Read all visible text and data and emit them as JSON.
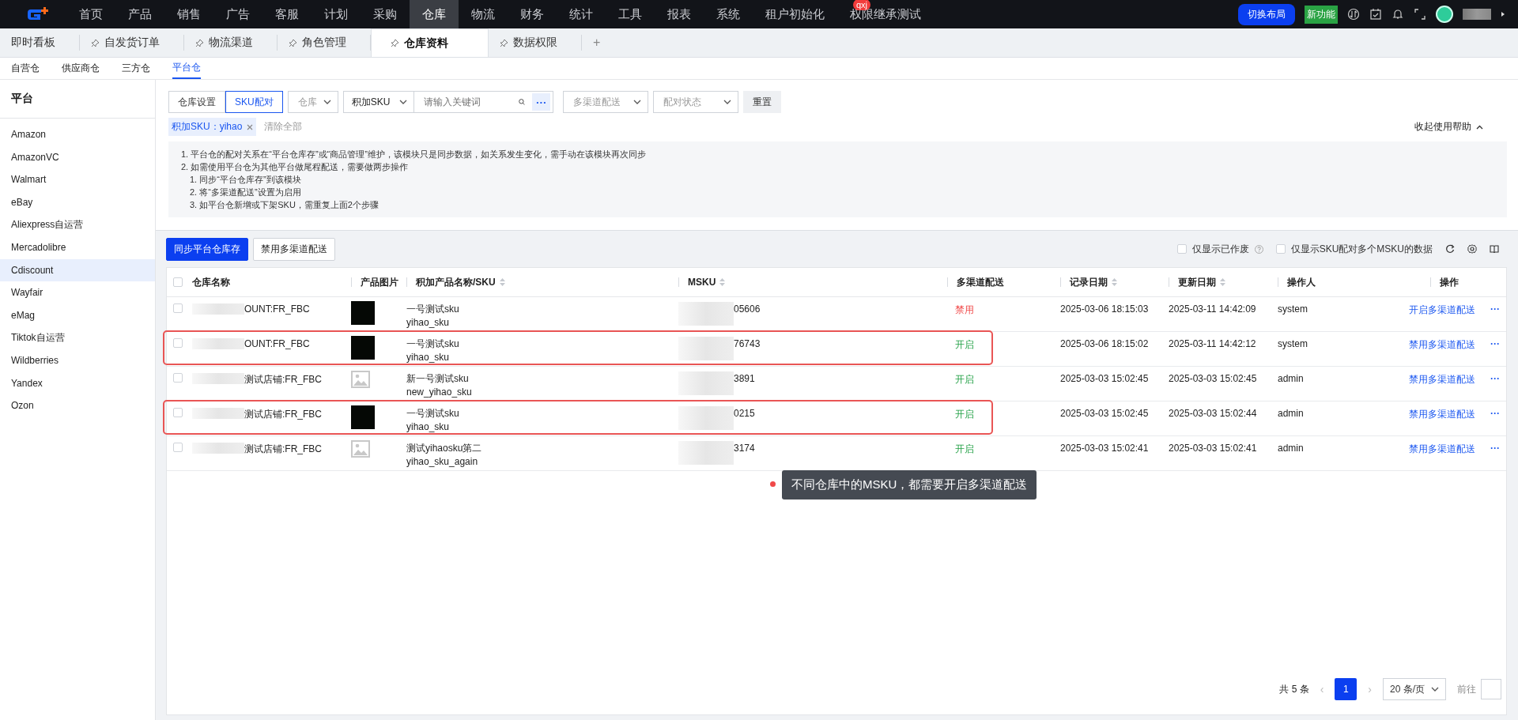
{
  "top_nav": {
    "items": [
      {
        "label": "首页",
        "selected": false
      },
      {
        "label": "产品",
        "selected": false
      },
      {
        "label": "销售",
        "selected": false
      },
      {
        "label": "广告",
        "selected": false
      },
      {
        "label": "客服",
        "selected": false
      },
      {
        "label": "计划",
        "selected": false
      },
      {
        "label": "采购",
        "selected": false
      },
      {
        "label": "仓库",
        "selected": true
      },
      {
        "label": "物流",
        "selected": false
      },
      {
        "label": "财务",
        "selected": false
      },
      {
        "label": "统计",
        "selected": false
      },
      {
        "label": "工具",
        "selected": false
      },
      {
        "label": "报表",
        "selected": false
      },
      {
        "label": "系统",
        "selected": false
      },
      {
        "label": "租户初始化",
        "selected": false
      },
      {
        "label": "权限继承测试",
        "selected": false,
        "badge": "qxj"
      }
    ],
    "layout_button": "切换布局",
    "new_feature": "新功能"
  },
  "tabs": [
    {
      "label": "即时看板",
      "selected": false,
      "pinned": false
    },
    {
      "label": "自发货订单",
      "selected": false,
      "pinned": true
    },
    {
      "label": "物流渠道",
      "selected": false,
      "pinned": true
    },
    {
      "label": "角色管理",
      "selected": false,
      "pinned": true
    },
    {
      "label": "仓库资料",
      "selected": true,
      "pinned": true
    },
    {
      "label": "数据权限",
      "selected": false,
      "pinned": true
    }
  ],
  "add_tab": "+",
  "sub_tabs": [
    {
      "label": "自营仓",
      "selected": false
    },
    {
      "label": "供应商仓",
      "selected": false
    },
    {
      "label": "三方仓",
      "selected": false
    },
    {
      "label": "平台仓",
      "selected": true
    }
  ],
  "sidebar": {
    "title": "平台",
    "items": [
      {
        "label": "Amazon",
        "selected": false
      },
      {
        "label": "AmazonVC",
        "selected": false
      },
      {
        "label": "Walmart",
        "selected": false
      },
      {
        "label": "eBay",
        "selected": false
      },
      {
        "label": "Aliexpress自运营",
        "selected": false
      },
      {
        "label": "Mercadolibre",
        "selected": false
      },
      {
        "label": "Cdiscount",
        "selected": true
      },
      {
        "label": "Wayfair",
        "selected": false
      },
      {
        "label": "eMag",
        "selected": false
      },
      {
        "label": "Tiktok自运营",
        "selected": false
      },
      {
        "label": "Wildberries",
        "selected": false
      },
      {
        "label": "Yandex",
        "selected": false
      },
      {
        "label": "Ozon",
        "selected": false
      }
    ]
  },
  "filters": {
    "mode": [
      {
        "label": "仓库设置",
        "selected": false
      },
      {
        "label": "SKU配对",
        "selected": true
      }
    ],
    "warehouse_select": {
      "placeholder": "仓库"
    },
    "search_field_select": "积加SKU",
    "keyword": {
      "placeholder": "请输入关键词"
    },
    "more": "···",
    "multi_channel_select": {
      "placeholder": "多渠道配送"
    },
    "pair_status_select": {
      "placeholder": "配对状态"
    },
    "reset": "重置",
    "active_tag": "积加SKU：yihao",
    "clear_all": "清除全部",
    "help_toggle": "收起使用帮助"
  },
  "help": [
    {
      "text": "1. 平台仓的配对关系在“平台仓库存”或“商品管理”维护，该模块只是同步数据，如关系发生变化，需手动在该模块再次同步"
    },
    {
      "text": "2. 如需使用平台仓为其他平台做尾程配送，需要做两步操作",
      "children": [
        {
          "text": "1. 同步“平台仓库存”到该模块"
        },
        {
          "text": "2. 将“多渠道配送”设置为启用"
        },
        {
          "text": "3. 如平台仓新增或下架SKU，需重复上面2个步骤"
        }
      ]
    }
  ],
  "toolbar": {
    "buttons": [
      {
        "label": "同步平台仓库存",
        "kind": "primary"
      },
      {
        "label": "禁用多渠道配送",
        "kind": "default"
      }
    ],
    "options": [
      {
        "label": "仅显示已作废",
        "checked": false,
        "help": true
      },
      {
        "label": "仅显示SKU配对多个MSKU的数据",
        "checked": false,
        "help": false
      }
    ]
  },
  "table": {
    "columns": [
      {
        "label": "仓库名称",
        "sortable": false
      },
      {
        "label": "产品图片",
        "sortable": false
      },
      {
        "label": "积加产品名称/SKU",
        "sortable": true
      },
      {
        "label": "MSKU",
        "sortable": true
      },
      {
        "label": "多渠道配送",
        "sortable": false
      },
      {
        "label": "记录日期",
        "sortable": true
      },
      {
        "label": "更新日期",
        "sortable": true
      },
      {
        "label": "操作人",
        "sortable": false
      },
      {
        "label": "操作",
        "sortable": false
      }
    ],
    "select_all": {
      "checked": false
    },
    "rows": [
      {
        "checked": false,
        "warehouse": "OUNT:FR_FBC",
        "kind": "photo",
        "name": "一号测试sku",
        "sku": "yihao_sku",
        "msku": "05606",
        "multi_channel": {
          "text": "禁用",
          "enabled": false
        },
        "record_date": "2025-03-06 18:15:03",
        "update_date": "2025-03-11 14:42:09",
        "operator": "system",
        "action": "开启多渠道配送",
        "annotated": false
      },
      {
        "checked": false,
        "warehouse": "OUNT:FR_FBC",
        "kind": "photo",
        "name": "一号测试sku",
        "sku": "yihao_sku",
        "msku": "76743",
        "multi_channel": {
          "text": "开启",
          "enabled": true
        },
        "record_date": "2025-03-06 18:15:02",
        "update_date": "2025-03-11 14:42:12",
        "operator": "system",
        "action": "禁用多渠道配送",
        "annotated": true
      },
      {
        "checked": false,
        "warehouse": "测试店铺:FR_FBC",
        "kind": "placeholder",
        "name": "新一号测试sku",
        "sku": "new_yihao_sku",
        "msku": "3891",
        "multi_channel": {
          "text": "开启",
          "enabled": true
        },
        "record_date": "2025-03-03 15:02:45",
        "update_date": "2025-03-03 15:02:45",
        "operator": "admin",
        "action": "禁用多渠道配送",
        "annotated": false
      },
      {
        "checked": false,
        "warehouse": "测试店铺:FR_FBC",
        "kind": "photo",
        "name": "一号测试sku",
        "sku": "yihao_sku",
        "msku": "0215",
        "multi_channel": {
          "text": "开启",
          "enabled": true
        },
        "record_date": "2025-03-03 15:02:45",
        "update_date": "2025-03-03 15:02:44",
        "operator": "admin",
        "action": "禁用多渠道配送",
        "annotated": true
      },
      {
        "checked": false,
        "warehouse": "测试店铺:FR_FBC",
        "kind": "placeholder",
        "name": "测试yihaosku第二",
        "sku": "yihao_sku_again",
        "msku": "3174",
        "multi_channel": {
          "text": "开启",
          "enabled": true
        },
        "record_date": "2025-03-03 15:02:41",
        "update_date": "2025-03-03 15:02:41",
        "operator": "admin",
        "action": "禁用多渠道配送",
        "annotated": false
      }
    ],
    "more_action": "···"
  },
  "tooltip": "不同仓库中的MSKU，都需要开启多渠道配送",
  "pagination": {
    "total": "共 5 条",
    "prev": "‹",
    "pages": [
      {
        "label": "1",
        "selected": true
      }
    ],
    "next": "›",
    "page_size": "20 条/页",
    "goto": "前往"
  }
}
